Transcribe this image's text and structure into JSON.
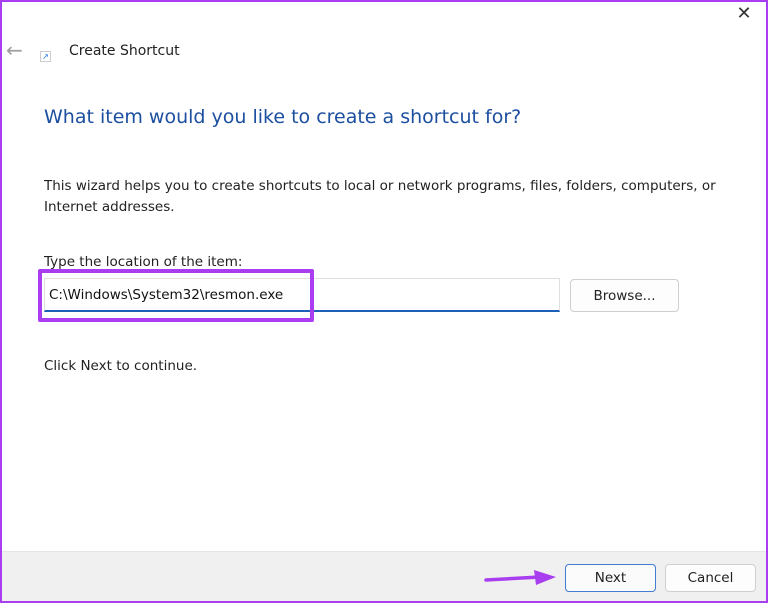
{
  "window": {
    "title": "Create Shortcut",
    "close_glyph": "✕",
    "back_glyph": "←",
    "app_icon_glyph": "↗"
  },
  "main": {
    "heading": "What item would you like to create a shortcut for?",
    "description": "This wizard helps you to create shortcuts to local or network programs, files, folders, computers, or Internet addresses.",
    "location_label": "Type the location of the item:",
    "location_value": "C:\\Windows\\System32\\resmon.exe",
    "browse_label": "Browse...",
    "continue_text": "Click Next to continue."
  },
  "footer": {
    "next_label": "Next",
    "cancel_label": "Cancel"
  },
  "colors": {
    "accent": "#1c4fa0",
    "annotation": "#a93ef0"
  }
}
